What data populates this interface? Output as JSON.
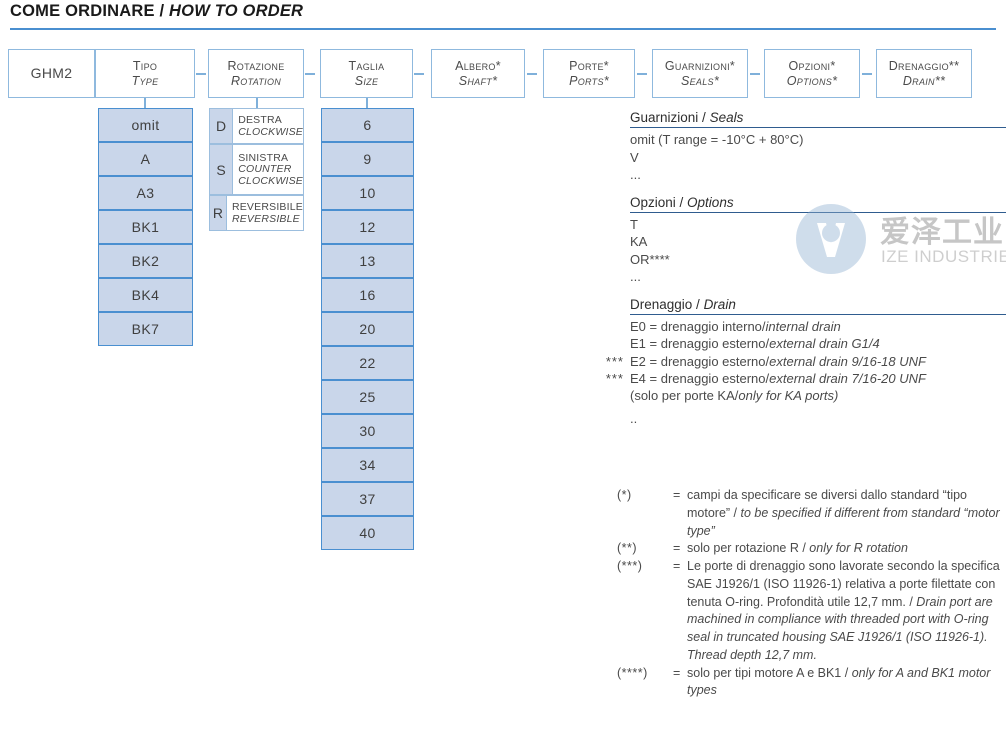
{
  "header": {
    "title_it": "COME ORDINARE",
    "title_sep": " / ",
    "title_en": "HOW TO ORDER"
  },
  "flow": {
    "boxes": [
      {
        "id": "model",
        "single": "GHM2"
      },
      {
        "id": "type",
        "it": "Tipo",
        "en": "Type"
      },
      {
        "id": "rotation",
        "it": "Rotazione",
        "en": "Rotation"
      },
      {
        "id": "size",
        "it": "Taglia",
        "en": "Size"
      },
      {
        "id": "shaft",
        "it": "Albero*",
        "en": "Shaft*"
      },
      {
        "id": "ports",
        "it": "Porte*",
        "en": "Ports*"
      },
      {
        "id": "seals",
        "it": "Guarnizioni*",
        "en": "Seals*"
      },
      {
        "id": "options",
        "it": "Opzioni*",
        "en": "Options*"
      },
      {
        "id": "drain",
        "it": "Drenaggio**",
        "en": "Drain**"
      }
    ],
    "type_values": [
      "omit",
      "A",
      "A3",
      "BK1",
      "BK2",
      "BK4",
      "BK7"
    ],
    "rotation_values": [
      {
        "code": "D",
        "it": "DESTRA",
        "en": "CLOCKWISE"
      },
      {
        "code": "S",
        "it": "SINISTRA",
        "en": "COUNTER CLOCKWISE"
      },
      {
        "code": "R",
        "it": "REVERSIBILE",
        "en": "REVERSIBLE"
      }
    ],
    "size_values": [
      "6",
      "9",
      "10",
      "12",
      "13",
      "16",
      "20",
      "22",
      "25",
      "30",
      "34",
      "37",
      "40"
    ]
  },
  "sections": {
    "seals": {
      "head_it": "Guarnizioni",
      "head_sep": " / ",
      "head_en": "Seals",
      "lines": [
        "omit (T range = -10°C + 80°C)",
        "V",
        "..."
      ]
    },
    "options": {
      "head_it": "Opzioni",
      "head_sep": " / ",
      "head_en": "Options",
      "lines": [
        "T",
        "KA",
        "OR****",
        "..."
      ]
    },
    "drain": {
      "head_it": "Drenaggio",
      "head_sep": " / ",
      "head_en": "Drain",
      "rows": [
        {
          "ast": "",
          "it": "E0 = drenaggio interno/",
          "en": "internal drain"
        },
        {
          "ast": "",
          "it": "E1 = drenaggio esterno/",
          "en": "external drain G1/4"
        },
        {
          "ast": "***",
          "it": "E2 = drenaggio esterno/",
          "en": "external drain 9/16-18 UNF"
        },
        {
          "ast": "***",
          "it": "E4 = drenaggio esterno/",
          "en": "external drain 7/16-20 UNF"
        },
        {
          "ast": "",
          "it": "(solo per porte KA/",
          "en": "only for KA ports)"
        },
        {
          "ast": "",
          "it": "..",
          "en": ""
        }
      ]
    }
  },
  "footnotes": [
    {
      "mark": "(*)",
      "eq": "=",
      "body_it": "campi da specificare se diversi dallo standard “tipo motore”",
      "body_sep": " / ",
      "body_en": "to be specified if different from standard “motor type”"
    },
    {
      "mark": "(**)",
      "eq": "=",
      "body_it": "solo per rotazione R",
      "body_sep": " / ",
      "body_en": "only for R rotation"
    },
    {
      "mark": "(***)",
      "eq": "=",
      "body_it": "Le porte di drenaggio sono lavorate secondo la specifica SAE J1926/1 (ISO 11926-1) relativa a porte filettate con tenuta O-ring. Profondità utile 12,7 mm.",
      "body_sep": " / ",
      "body_en": "Drain port are machined in compliance with threaded port with O-ring seal in truncated housing SAE J1926/1 (ISO 11926-1). Thread depth 12,7 mm."
    },
    {
      "mark": "(****)",
      "eq": "=",
      "body_it": "solo per tipi motore A e BK1",
      "body_sep": " / ",
      "body_en": "only for A and BK1 motor types"
    }
  ],
  "watermark": {
    "cn": "爱泽工业",
    "en": "IZE INDUSTRIES"
  },
  "colors": {
    "accent": "#4a8fd0",
    "box_border": "#8fb9de",
    "cell_fill": "#c9d6ea",
    "rule": "#2f5c8f"
  }
}
